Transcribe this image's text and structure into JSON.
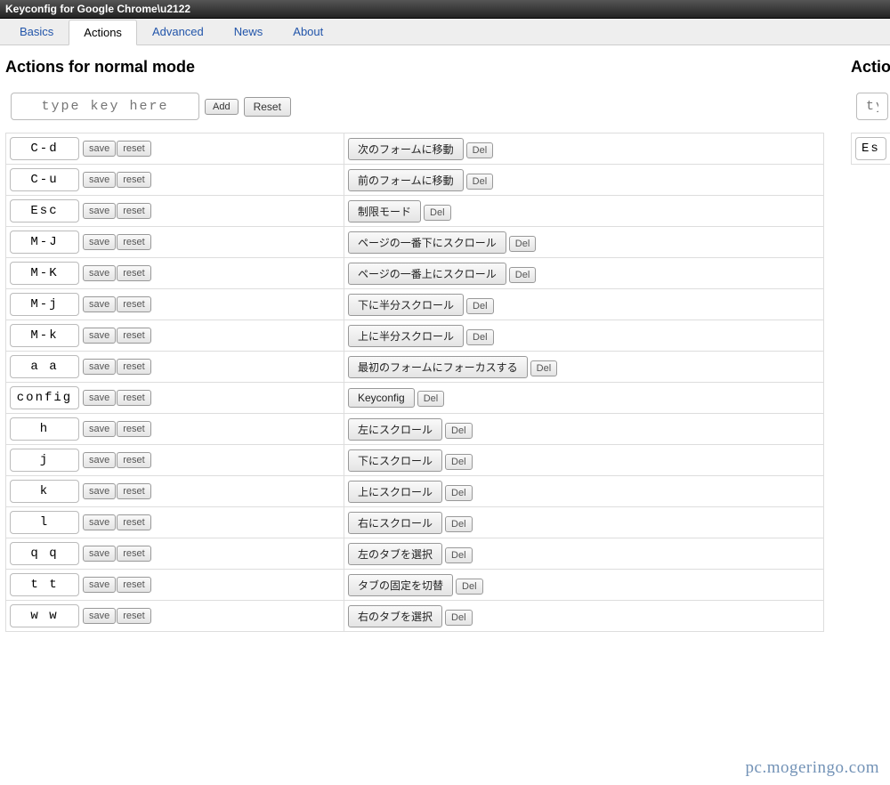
{
  "window_title": "Keyconfig for Google Chrome\\u2122",
  "tabs": [
    {
      "label": "Basics",
      "active": false
    },
    {
      "label": "Actions",
      "active": true
    },
    {
      "label": "Advanced",
      "active": false
    },
    {
      "label": "News",
      "active": false
    },
    {
      "label": "About",
      "active": false
    }
  ],
  "normal": {
    "title": "Actions for normal mode",
    "key_placeholder": "type key here",
    "add_label": "Add",
    "reset_label": "Reset",
    "save_label": "save",
    "row_reset_label": "reset",
    "del_label": "Del",
    "rows": [
      {
        "key": "C-d",
        "action": "次のフォームに移動"
      },
      {
        "key": "C-u",
        "action": "前のフォームに移動"
      },
      {
        "key": "Esc",
        "action": "制限モード"
      },
      {
        "key": "M-J",
        "action": "ページの一番下にスクロール"
      },
      {
        "key": "M-K",
        "action": "ページの一番上にスクロール"
      },
      {
        "key": "M-j",
        "action": "下に半分スクロール"
      },
      {
        "key": "M-k",
        "action": "上に半分スクロール"
      },
      {
        "key": "a a",
        "action": "最初のフォームにフォーカスする"
      },
      {
        "key": "config",
        "action": "Keyconfig"
      },
      {
        "key": "h",
        "action": "左にスクロール"
      },
      {
        "key": "j",
        "action": "下にスクロール"
      },
      {
        "key": "k",
        "action": "上にスクロール"
      },
      {
        "key": "l",
        "action": "右にスクロール"
      },
      {
        "key": "q q",
        "action": "左のタブを選択"
      },
      {
        "key": "t t",
        "action": "タブの固定を切替"
      },
      {
        "key": "w w",
        "action": "右のタブを選択"
      }
    ]
  },
  "right_panel": {
    "title_fragment": "Action",
    "key_placeholder_fragment": "typ",
    "row_key_fragment": "Es"
  },
  "watermark": "pc.mogeringo.com"
}
